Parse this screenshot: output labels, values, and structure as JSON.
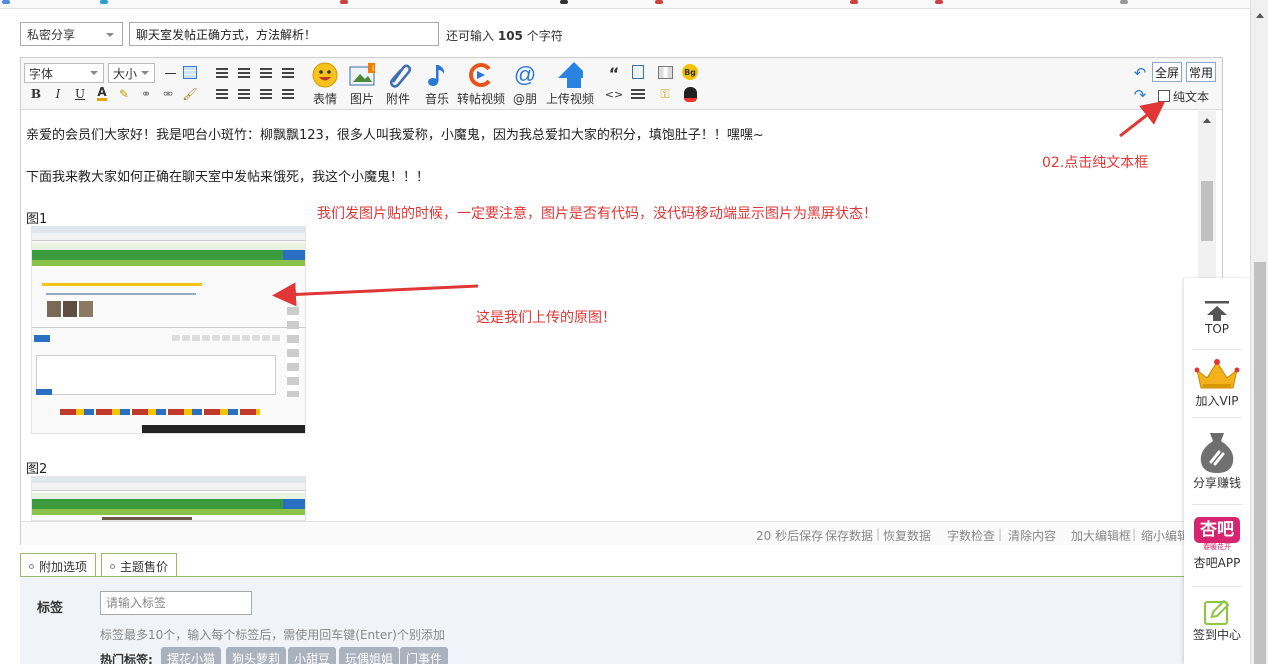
{
  "form": {
    "privacy_select": "私密分享",
    "title_value": "聊天室发帖正确方式，方法解析！",
    "remain_prefix": "还可输入",
    "remain_count": "105",
    "remain_suffix": "个字符"
  },
  "toolbar": {
    "font_select": "字体",
    "size_select": "大小",
    "bold": "B",
    "italic": "I",
    "underline": "U",
    "big_buttons": [
      "表情",
      "图片",
      "附件",
      "音乐",
      "转帖视频",
      "@朋",
      "上传视频"
    ],
    "fullscreen": "全屏",
    "common": "常用",
    "plain_text": "纯文本",
    "quote_glyph": "“",
    "bg_badge": "Bg",
    "code_glyph": "<>"
  },
  "content": {
    "line1": "亲爱的会员们大家好！我是吧台小斑竹：柳飘飘123，很多人叫我爱称，小魔鬼，因为我总爱扣大家的积分，填饱肚子！！嘿嘿~",
    "line2": "下面我来教大家如何正确在聊天室中发帖来饿死，我这个小魔鬼！！！",
    "fig1": "图1",
    "fig2": "图2",
    "note_code": "我们发图片贴的时候，一定要注意，图片是否有代码，没代码移动端显示图片为黑屏状态！",
    "note_original": "这是我们上传的原图！",
    "note_plain": "02.点击纯文本框"
  },
  "statusbar": {
    "autosave": "20 秒后保存",
    "save": "保存数据",
    "restore": "恢复数据",
    "count": "字数检查",
    "clear": "清除内容",
    "enlarge": "加大编辑框",
    "shrink": "缩小编辑"
  },
  "extra": {
    "tab_options": "附加选项",
    "tab_sale": "主题售价",
    "tag_label": "标签",
    "tag_placeholder": "请输入标签",
    "tag_hint": "标签最多10个，输入每个标签后，需使用回车键(Enter)个别添加",
    "hot_label": "热门标签:",
    "hot_tags": [
      "摆花小猫",
      "狗头萝莉",
      "小甜豆",
      "玩偶姐姐",
      "门事件"
    ]
  },
  "sidepanel": {
    "top": "TOP",
    "vip": "加入VIP",
    "share": "分享赚钱",
    "app_logo": "杏吧",
    "app_sub": "春暖花开",
    "app": "杏吧APP",
    "checkin": "签到中心"
  },
  "colors": {
    "annotation_red": "#e03636",
    "green_border": "#9ab86a",
    "tag_gray": "#aab2be",
    "app_magenta": "#d6246e"
  }
}
